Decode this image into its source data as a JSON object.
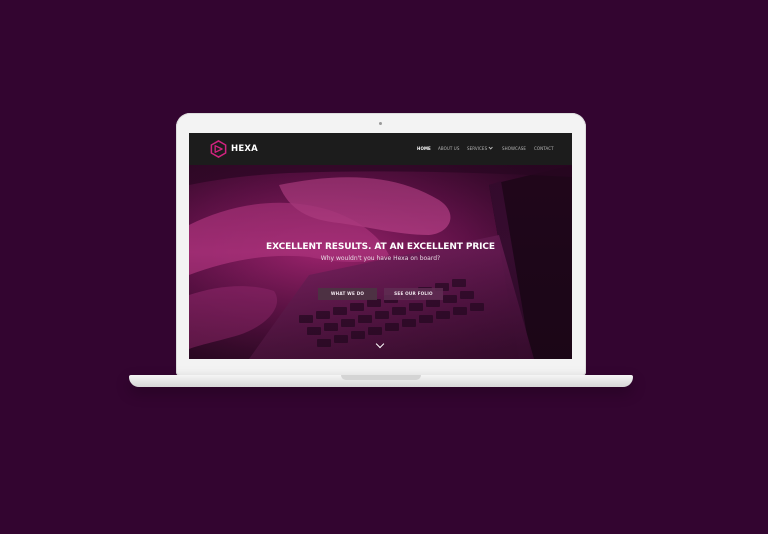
{
  "brand": {
    "name": "HEXA",
    "accent_color": "#d0237f"
  },
  "nav": {
    "items": [
      {
        "label": "HOME",
        "active": true
      },
      {
        "label": "ABOUT US",
        "active": false
      },
      {
        "label": "SERVICES",
        "active": false,
        "has_dropdown": true
      },
      {
        "label": "SHOWCASE",
        "active": false
      },
      {
        "label": "CONTACT",
        "active": false
      }
    ]
  },
  "hero": {
    "title": "EXCELLENT RESULTS. AT AN EXCELLENT PRICE",
    "subtitle": "Why wouldn't you have Hexa on board?",
    "primary_button": "WHAT WE DO",
    "secondary_button": "SEE OUR FOLIO",
    "scroll_icon": "chevron-down-icon"
  },
  "colors": {
    "page_background": "#330530",
    "navbar_background": "#1c1c1c",
    "hero_tint": "#a3226f"
  }
}
